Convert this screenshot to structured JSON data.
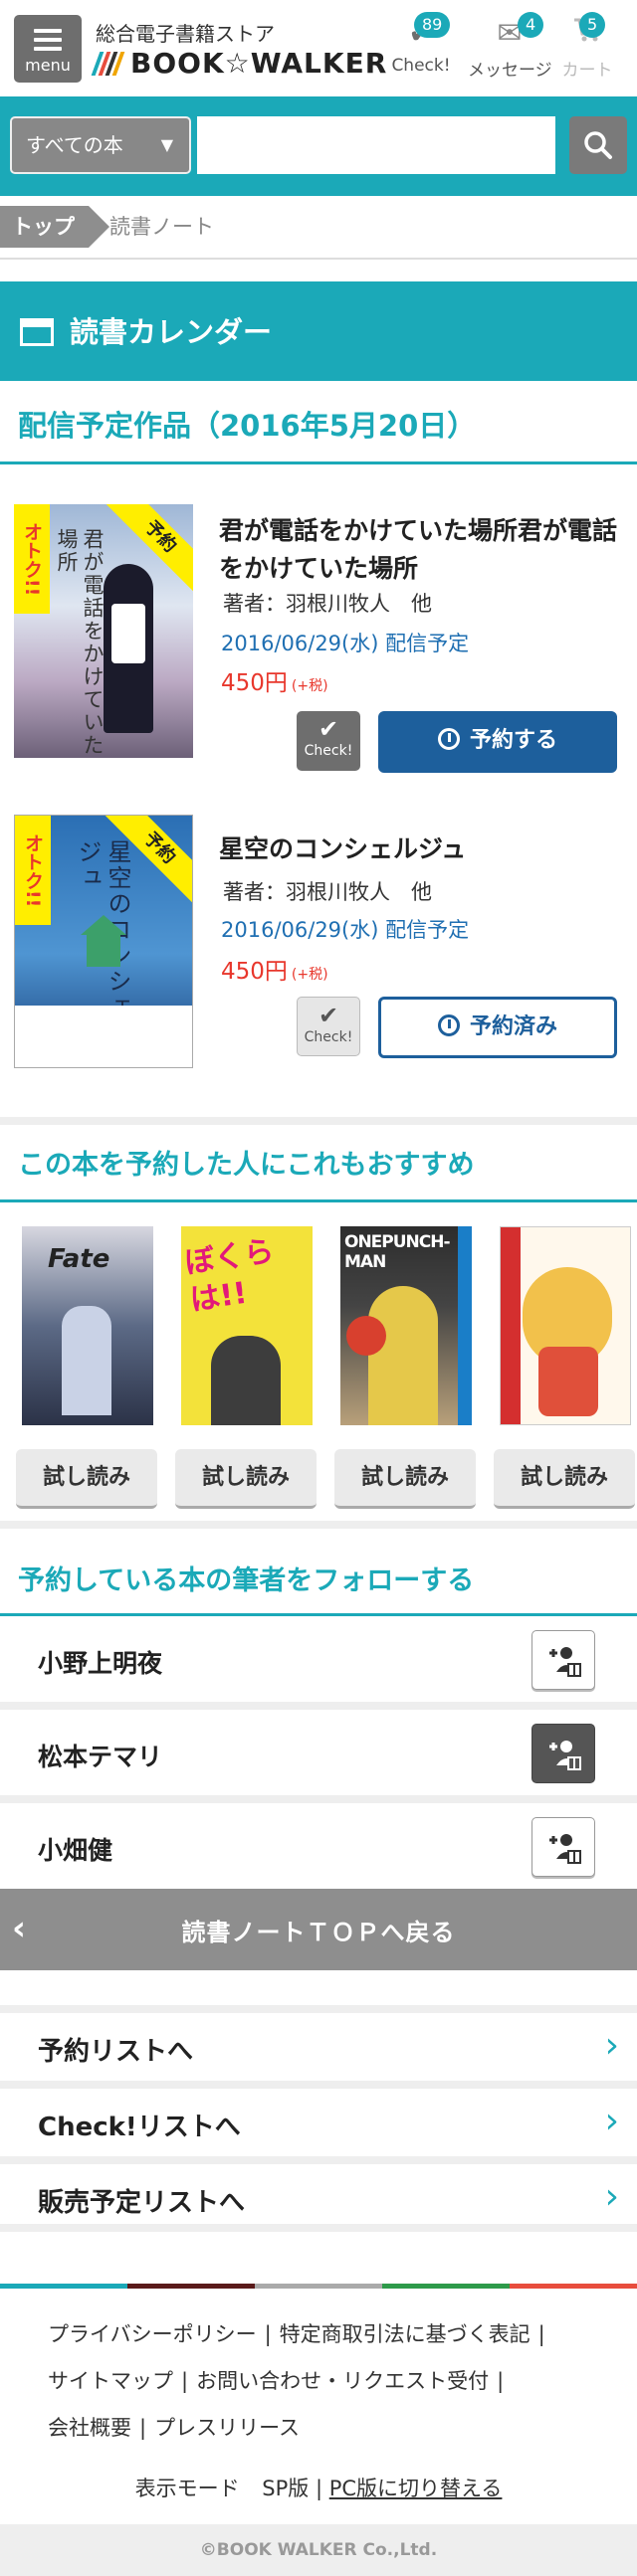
{
  "header": {
    "menu_label": "menu",
    "store_subtitle": "総合電子書籍ストア",
    "logo_text": "BOOK☆WALKER",
    "logo_bar_colors": [
      "#1ba9b8",
      "#e84d3d",
      "#333333",
      "#f0a500"
    ],
    "check": {
      "label": "Check!",
      "count": "89"
    },
    "messages": {
      "label": "メッセージ",
      "count": "4"
    },
    "cart": {
      "label": "カート",
      "count": "5"
    }
  },
  "search": {
    "category": "すべての本",
    "input_value": ""
  },
  "breadcrumb": {
    "top": "トップ",
    "current": "読書ノート"
  },
  "calendar": {
    "title": "読書カレンダー",
    "subtitle": "配信予定作品（2016年5月20日）"
  },
  "books": [
    {
      "title": "君が電話をかけていた場所君が電話をかけていた場所",
      "author": "著者：羽根川牧人　他",
      "date": "2016/06/29(水) 配信予定",
      "price": "450円",
      "tax": "(+税)",
      "check_label": "Check!",
      "reserve_label": "予約する",
      "ribbon": "オトク!!",
      "tag": "予約",
      "cover_title": "君が電話をかけていた場所"
    },
    {
      "title": "星空のコンシェルジュ",
      "author": "著者：羽根川牧人　他",
      "date": "2016/06/29(水) 配信予定",
      "price": "450円",
      "tax": "(+税)",
      "check_label": "Check!",
      "reserve_label": "予約済み",
      "ribbon": "オトク!!",
      "tag": "予約",
      "cover_title": "星空のコンシェルジュ"
    }
  ],
  "recommend": {
    "title": "この本を予約した人にこれもおすすめ",
    "items": [
      {
        "cover_text": "Fate",
        "button": "試し読み"
      },
      {
        "cover_text": "ぼくらは!!",
        "button": "試し読み"
      },
      {
        "cover_text": "ONEPUNCH-MAN",
        "button": "試し読み"
      },
      {
        "cover_text": "",
        "button": "試し読み"
      }
    ]
  },
  "follow": {
    "title": "予約している本の筆者をフォローする",
    "authors": [
      "小野上明夜",
      "松本テマリ",
      "小畑健"
    ]
  },
  "back_label": "読書ノートＴＯＰへ戻る",
  "links": [
    "予約リストへ",
    "Check!リストへ",
    "販売予定リストへ"
  ],
  "footer": {
    "links": [
      "プライバシーポリシー",
      "特定商取引法に基づく表記",
      "サイトマップ",
      "お問い合わせ・リクエスト受付",
      "会社概要",
      "プレスリリース"
    ],
    "display_mode_label": "表示モード",
    "sp_label": "SP版",
    "pc_label": "PC版に切り替える",
    "strip_colors": [
      "#1ba9b8",
      "#5a1a1a",
      "#aaaaaa",
      "#2e9a4a",
      "#e84d3d"
    ],
    "copyright": "©BOOK WALKER Co.,Ltd."
  },
  "colors": {
    "accent": "#1ba9b8",
    "reserve_blue": "#1d5f9c",
    "price_red": "#e8372c"
  }
}
